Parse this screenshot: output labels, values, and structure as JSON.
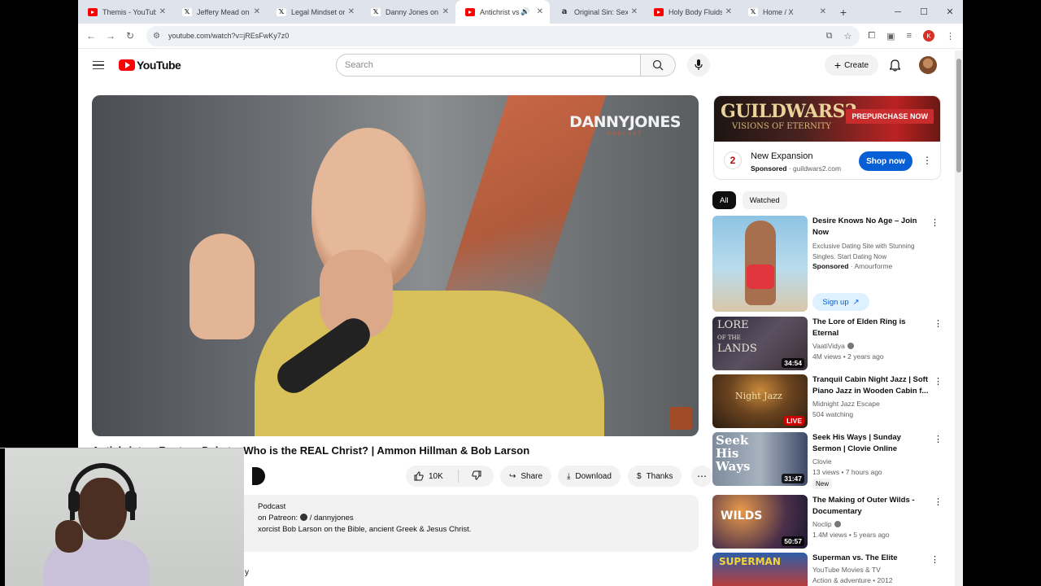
{
  "browser": {
    "tabs": [
      {
        "icon": "youtube-icon",
        "label": "Themis - YouTube"
      },
      {
        "icon": "x-icon",
        "label": "Jeffery Mead on X"
      },
      {
        "icon": "x-icon",
        "label": "Legal Mindset on X"
      },
      {
        "icon": "x-icon",
        "label": "Danny Jones on X"
      },
      {
        "icon": "youtube-icon",
        "label": "Antichrist vs R",
        "active": true
      },
      {
        "icon": "amazon-icon",
        "label": "Original Sin: Sex"
      },
      {
        "icon": "youtube-icon",
        "label": "Holy Body Fluids"
      },
      {
        "icon": "x-icon",
        "label": "Home / X"
      }
    ],
    "url": "youtube.com/watch?v=jREsFwKy7z0",
    "profile_initial": "K"
  },
  "header": {
    "logo_text": "YouTube",
    "search_placeholder": "Search",
    "create_label": "Create"
  },
  "video": {
    "overlay_brand": "DANNYJONES",
    "overlay_brand_sub": "PODCAST",
    "title": "Antichrist vs Rapture Debate: Who is the REAL Christ? | Ammon Hillman & Bob Larson",
    "likes": "10K",
    "share_label": "Share",
    "download_label": "Download",
    "thanks_label": "Thanks"
  },
  "description": {
    "line1": "Podcast",
    "line2_prefix": "on Patreon:",
    "line2_link": "/ dannyjones",
    "line3": "xorcist Bob Larson on the Bible, ancient Greek & Jesus Christ."
  },
  "comments_fragment": "y",
  "ad": {
    "banner_title": "GUILDWARS2",
    "banner_sub": "VISIONS OF ETERNITY",
    "banner_cta": "PREPURCHASE NOW",
    "title": "New Expansion",
    "sponsored": "Sponsored",
    "domain": "guildwars2.com",
    "button": "Shop now"
  },
  "chips": [
    {
      "label": "All",
      "active": true
    },
    {
      "label": "Watched",
      "active": false
    }
  ],
  "recommendations": [
    {
      "title": "Desire Knows No Age – Join Now",
      "line1": "Exclusive Dating Site with Stunning Singles. Start Dating Now",
      "sponsored": "Sponsored",
      "advertiser": "Amourforme",
      "signup": "Sign up"
    },
    {
      "title": "The Lore of Elden Ring is Eternal",
      "channel": "VaatiVidya",
      "meta": "4M views • 2 years ago",
      "duration": "34:54"
    },
    {
      "title": "Tranquil Cabin Night Jazz | Soft Piano Jazz in Wooden Cabin f...",
      "channel": "Midnight Jazz Escape",
      "meta": "504 watching",
      "live": "LIVE"
    },
    {
      "title": "Seek His Ways | Sunday Sermon | Clovie Online",
      "channel": "Clovie",
      "meta": "13 views • 7 hours ago",
      "badge": "New",
      "duration": "31:47"
    },
    {
      "title": "The Making of Outer Wilds - Documentary",
      "channel": "Noclip",
      "meta": "1.4M views • 5 years ago",
      "duration": "50:57"
    },
    {
      "title": "Superman vs. The Elite",
      "channel": "YouTube Movies & TV",
      "meta": "Action & adventure • 2012"
    }
  ]
}
